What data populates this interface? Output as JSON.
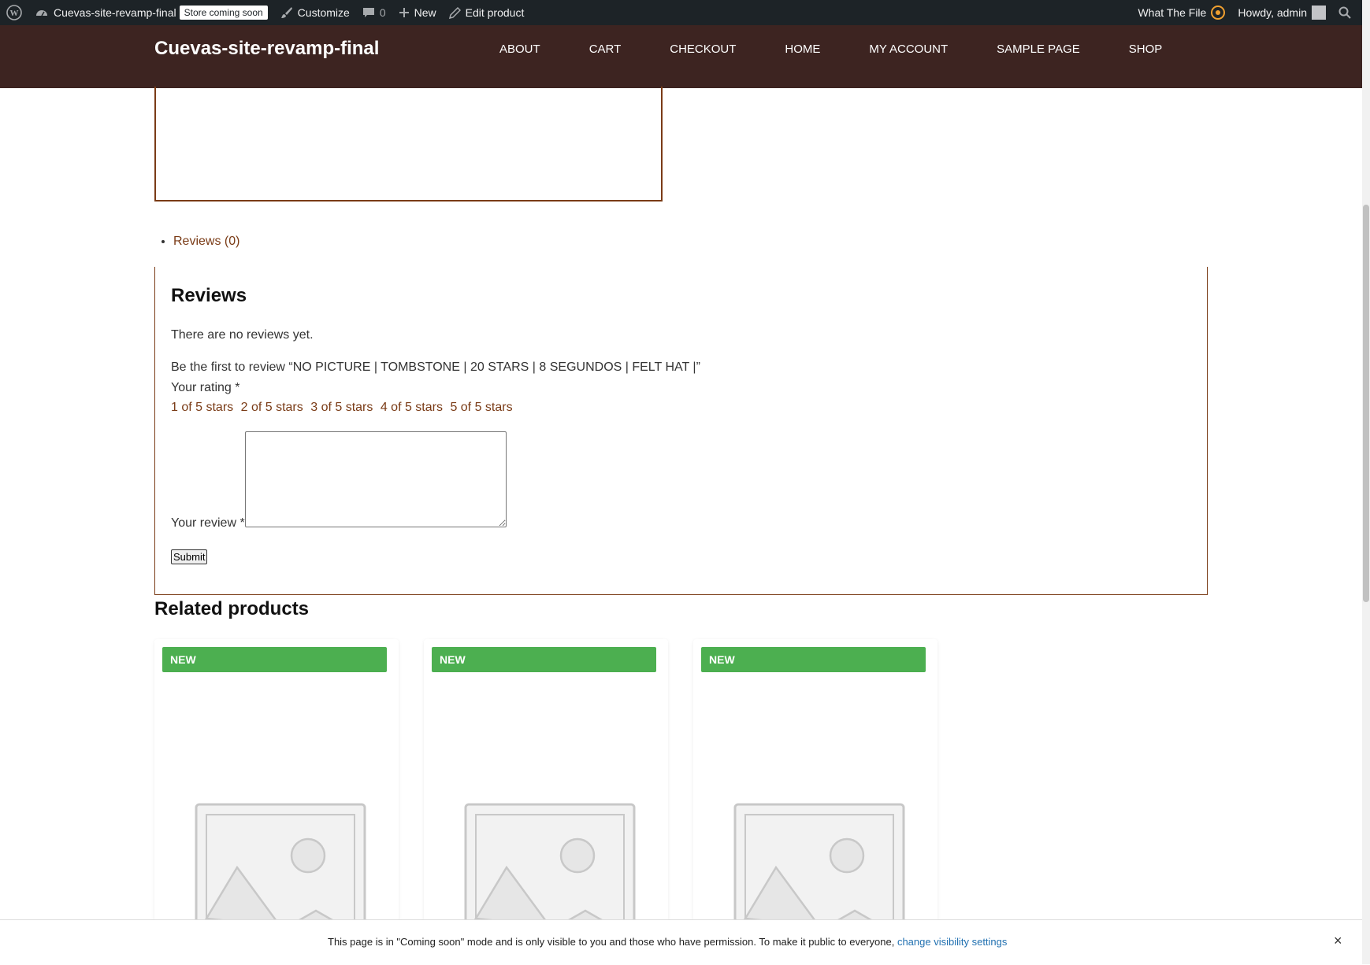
{
  "admin_bar": {
    "site_name": "Cuevas-site-revamp-final",
    "store_badge": "Store coming soon",
    "customize": "Customize",
    "comments_count": "0",
    "new": "New",
    "edit_product": "Edit product",
    "what_the_file": "What The File",
    "howdy": "Howdy, admin"
  },
  "header": {
    "site_title": "Cuevas-site-revamp-final",
    "nav": [
      "ABOUT",
      "CART",
      "CHECKOUT",
      "HOME",
      "MY ACCOUNT",
      "SAMPLE PAGE",
      "SHOP"
    ]
  },
  "tabs": {
    "reviews_tab": "Reviews (0)"
  },
  "reviews": {
    "title": "Reviews",
    "no_reviews": "There are no reviews yet.",
    "first_review": "Be the first to review “NO PICTURE | TOMBSTONE | 20 STARS | 8 SEGUNDOS | FELT HAT |”",
    "rating_label": "Your rating *",
    "stars": [
      "1 of 5 stars",
      "2 of 5 stars",
      "3 of 5 stars",
      "4 of 5 stars",
      "5 of 5 stars"
    ],
    "review_label": "Your review *",
    "submit": "Submit"
  },
  "related": {
    "title": "Related products",
    "products": [
      {
        "badge": "NEW"
      },
      {
        "badge": "NEW"
      },
      {
        "badge": "NEW"
      }
    ]
  },
  "coming_soon": {
    "text": "This page is in \"Coming soon\" mode and is only visible to you and those who have permission. To make it public to everyone, ",
    "link": "change visibility settings",
    "close": "×"
  },
  "colors": {
    "header_bg": "#3d2421",
    "accent": "#7a3b16",
    "badge_green": "#4caf50",
    "admin_bar_bg": "#1d2327",
    "link_blue": "#2271b1"
  }
}
